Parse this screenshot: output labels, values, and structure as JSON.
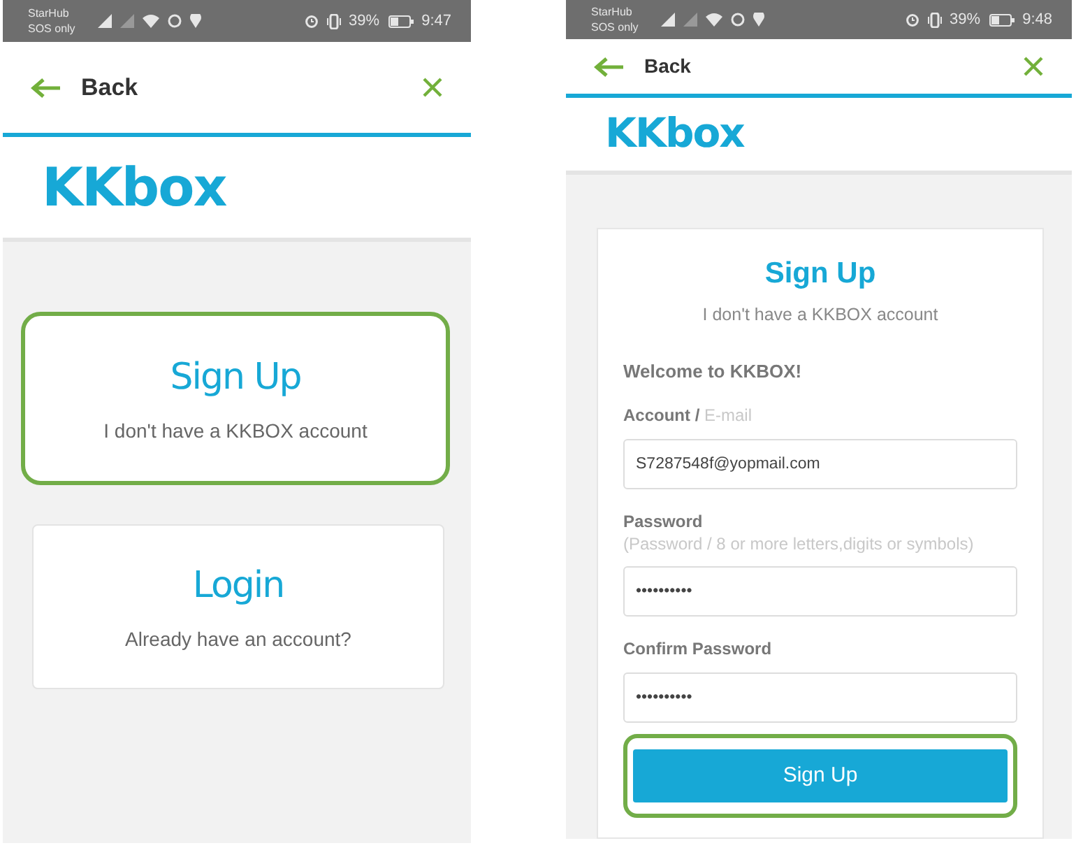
{
  "left_screen": {
    "status_bar": {
      "carrier": "StarHub",
      "network": "SOS only",
      "battery": "39%",
      "time": "9:47"
    },
    "header": {
      "back": "Back"
    },
    "logo": "KKbox",
    "options": [
      {
        "title": "Sign Up",
        "subtitle": "I don't have a KKBOX account",
        "highlighted": true
      },
      {
        "title": "Login",
        "subtitle": "Already have an account?",
        "highlighted": false
      }
    ]
  },
  "right_screen": {
    "status_bar": {
      "carrier": "StarHub",
      "network": "SOS only",
      "battery": "39%",
      "time": "9:48"
    },
    "header": {
      "back": "Back"
    },
    "logo": "KKbox",
    "form": {
      "title": "Sign Up",
      "subtitle": "I don't have a KKBOX account",
      "welcome": "Welcome to KKBOX!",
      "fields": [
        {
          "label": "Account /",
          "hint": "E-mail",
          "value": "S7287548f@yopmail.com"
        },
        {
          "label": "Password",
          "hint": "(Password / 8 or more letters,digits or symbols)",
          "value": "••••••••••"
        },
        {
          "label": "Confirm Password",
          "value": "••••••••••"
        }
      ],
      "button": {
        "label": "Sign Up",
        "highlighted": true
      }
    }
  }
}
